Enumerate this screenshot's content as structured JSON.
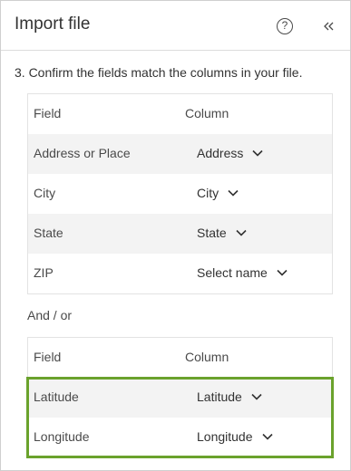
{
  "header": {
    "title": "Import file",
    "help_label": "?"
  },
  "step_text": "3.  Confirm the fields match the columns in your file.",
  "table1": {
    "field_header": "Field",
    "column_header": "Column",
    "rows": [
      {
        "field": "Address or Place",
        "column": "Address"
      },
      {
        "field": "City",
        "column": "City"
      },
      {
        "field": "State",
        "column": "State"
      },
      {
        "field": "ZIP",
        "column": "Select name"
      }
    ]
  },
  "andor": "And / or",
  "table2": {
    "field_header": "Field",
    "column_header": "Column",
    "rows": [
      {
        "field": "Latitude",
        "column": "Latitude"
      },
      {
        "field": "Longitude",
        "column": "Longitude"
      }
    ]
  },
  "colors": {
    "highlight": "#6aa22c",
    "row_shade": "#f3f3f3",
    "text": "#323232"
  },
  "icons": {
    "help": "help-circle-icon",
    "collapse": "double-chevron-left-icon",
    "dropdown": "chevron-down-icon"
  }
}
